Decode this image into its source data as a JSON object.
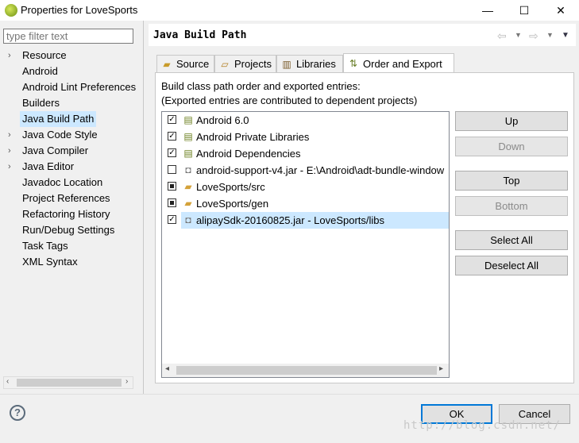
{
  "window": {
    "title": "Properties for LoveSports",
    "minimize": "—",
    "maximize": "☐",
    "close": "✕"
  },
  "filter": {
    "placeholder": "type filter text"
  },
  "tree": [
    {
      "label": "Resource",
      "expandable": true
    },
    {
      "label": "Android",
      "expandable": false
    },
    {
      "label": "Android Lint Preferences",
      "expandable": false
    },
    {
      "label": "Builders",
      "expandable": false
    },
    {
      "label": "Java Build Path",
      "expandable": false,
      "selected": true
    },
    {
      "label": "Java Code Style",
      "expandable": true
    },
    {
      "label": "Java Compiler",
      "expandable": true
    },
    {
      "label": "Java Editor",
      "expandable": true
    },
    {
      "label": "Javadoc Location",
      "expandable": false
    },
    {
      "label": "Project References",
      "expandable": false
    },
    {
      "label": "Refactoring History",
      "expandable": false
    },
    {
      "label": "Run/Debug Settings",
      "expandable": false
    },
    {
      "label": "Task Tags",
      "expandable": false
    },
    {
      "label": "XML Syntax",
      "expandable": false
    }
  ],
  "page": {
    "title": "Java Build Path"
  },
  "tabs": [
    {
      "label": "Source",
      "icon": "folder-icon"
    },
    {
      "label": "Projects",
      "icon": "projects-icon"
    },
    {
      "label": "Libraries",
      "icon": "libraries-icon"
    },
    {
      "label": "Order and Export",
      "icon": "order-export-icon",
      "active": true
    }
  ],
  "description": {
    "line1": "Build class path order and exported entries:",
    "line2": "(Exported entries are contributed to dependent projects)"
  },
  "entries": [
    {
      "label": "Android 6.0",
      "check": "checked",
      "icon": "library-icon"
    },
    {
      "label": "Android Private Libraries",
      "check": "checked",
      "icon": "library-icon"
    },
    {
      "label": "Android Dependencies",
      "check": "checked",
      "icon": "library-icon"
    },
    {
      "label": "android-support-v4.jar - E:\\Android\\adt-bundle-window",
      "check": "unchecked",
      "icon": "jar-icon"
    },
    {
      "label": "LoveSports/src",
      "check": "partial",
      "icon": "source-folder-icon"
    },
    {
      "label": "LoveSports/gen",
      "check": "partial",
      "icon": "source-folder-icon"
    },
    {
      "label": "alipaySdk-20160825.jar - LoveSports/libs",
      "check": "checked",
      "icon": "jar-icon",
      "selected": true
    }
  ],
  "buttons": {
    "up": "Up",
    "down": "Down",
    "top": "Top",
    "bottom": "Bottom",
    "select_all": "Select All",
    "deselect_all": "Deselect All"
  },
  "dialog": {
    "ok": "OK",
    "cancel": "Cancel",
    "help": "?"
  },
  "watermark": "http://blog.csdn.net/"
}
